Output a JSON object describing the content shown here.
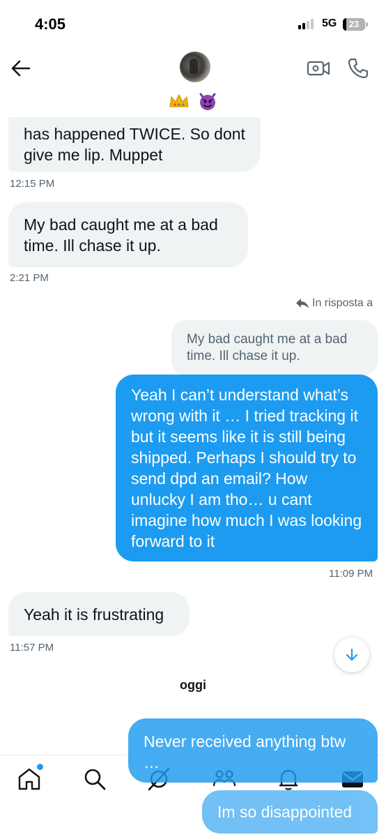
{
  "status_bar": {
    "time": "4:05",
    "network": "5G",
    "battery": "23"
  },
  "header": {
    "icons": [
      "back-arrow-icon",
      "avatar",
      "crown-emoji",
      "devil-emoji",
      "video-call-icon",
      "phone-call-icon"
    ]
  },
  "messages": {
    "m1": {
      "text": "has happened TWICE. So dont give me lip. Muppet",
      "time": "12:15 PM"
    },
    "m2": {
      "text": "My bad caught me at a bad time. Ill chase it up.",
      "time": "2:21 PM"
    },
    "reply": {
      "label": "In risposta a",
      "quoted": "My bad caught me at a bad time. Ill chase it up."
    },
    "m3": {
      "text": "Yeah I can’t understand what’s wrong with it … I tried tracking it but it seems like it is still being shipped. Perhaps I should try to send dpd an email? How unlucky I am tho… u cant imagine how much I was looking forward to it",
      "time": "11:09 PM"
    },
    "m4": {
      "text": "Yeah it is frustrating",
      "time": "11:57 PM"
    },
    "day_separator": "oggi",
    "m5": {
      "text": "Never received anything btw …"
    },
    "m6": {
      "text": "Im so disappointed"
    }
  },
  "colors": {
    "accent": "#1d9bf0",
    "received_bubble": "#eff3f4",
    "muted_text": "#536471"
  },
  "tabbar": {
    "items": [
      "home-icon",
      "search-icon",
      "grok-icon",
      "communities-icon",
      "notifications-icon",
      "messages-icon"
    ]
  }
}
